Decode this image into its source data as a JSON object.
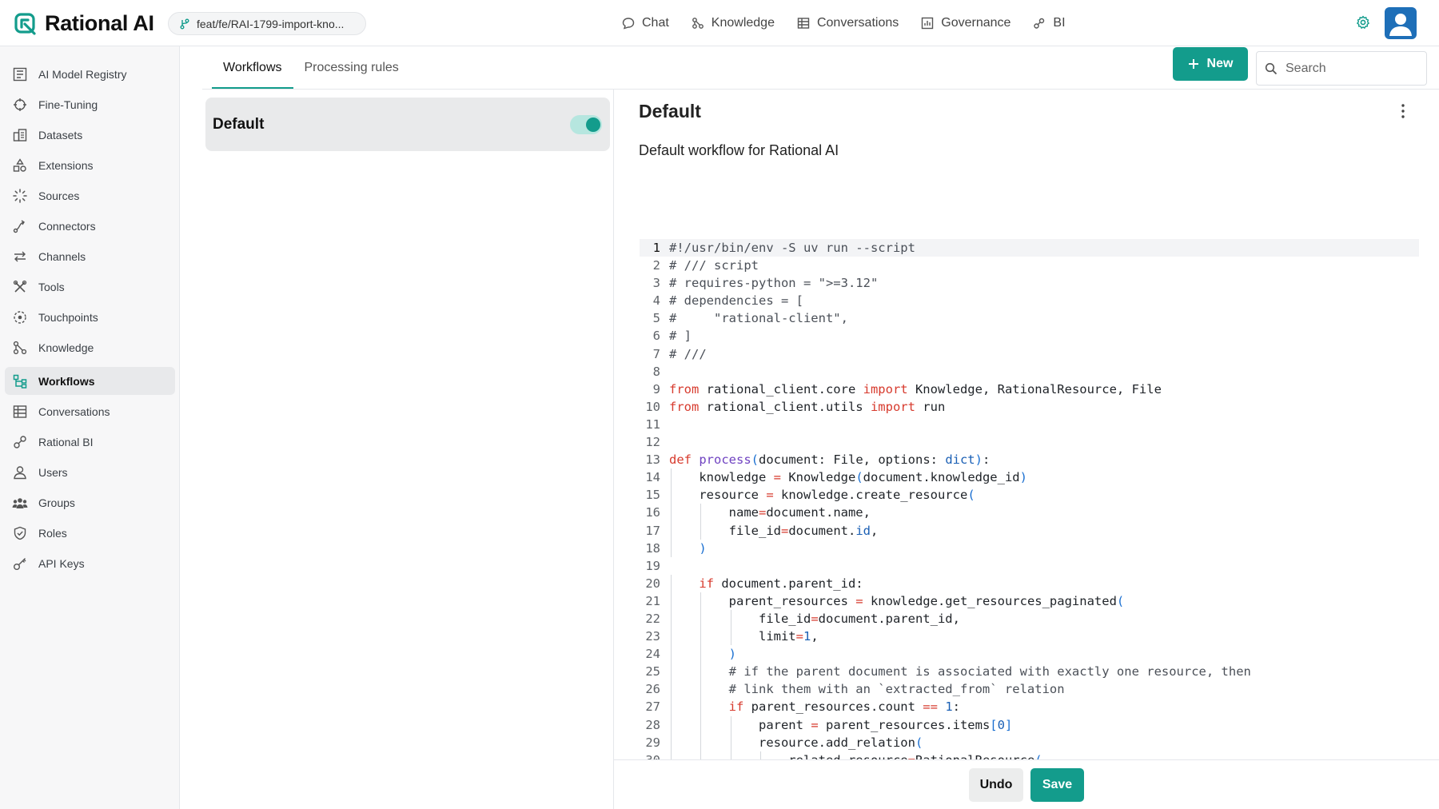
{
  "app": {
    "brand": "Rational AI",
    "branch": "feat/fe/RAI-1799-import-kno...",
    "accent_color": "#139c8c"
  },
  "topnav": [
    {
      "label": "Chat",
      "icon": "chat-icon"
    },
    {
      "label": "Knowledge",
      "icon": "knowledge-icon"
    },
    {
      "label": "Conversations",
      "icon": "table-icon"
    },
    {
      "label": "Governance",
      "icon": "governance-icon"
    },
    {
      "label": "BI",
      "icon": "bi-icon"
    }
  ],
  "sidebar": {
    "items": [
      {
        "label": "AI Model Registry",
        "icon": "registry-icon"
      },
      {
        "label": "Fine-Tuning",
        "icon": "fine-tuning-icon"
      },
      {
        "label": "Datasets",
        "icon": "datasets-icon"
      },
      {
        "label": "Extensions",
        "icon": "extensions-icon"
      },
      {
        "label": "Sources",
        "icon": "sources-icon"
      },
      {
        "label": "Connectors",
        "icon": "connectors-icon"
      },
      {
        "label": "Channels",
        "icon": "channels-icon"
      },
      {
        "label": "Tools",
        "icon": "tools-icon"
      },
      {
        "label": "Touchpoints",
        "icon": "touchpoints-icon"
      },
      {
        "label": "Knowledge",
        "icon": "knowledge-icon"
      },
      {
        "label": "Workflows",
        "icon": "workflows-icon",
        "active": true
      },
      {
        "label": "Conversations",
        "icon": "table-icon"
      },
      {
        "label": "Rational BI",
        "icon": "bi-icon"
      },
      {
        "label": "Users",
        "icon": "user-icon"
      },
      {
        "label": "Groups",
        "icon": "groups-icon"
      },
      {
        "label": "Roles",
        "icon": "shield-icon"
      },
      {
        "label": "API Keys",
        "icon": "key-icon"
      }
    ]
  },
  "tabs": [
    {
      "label": "Workflows",
      "active": true
    },
    {
      "label": "Processing rules",
      "active": false
    }
  ],
  "toolbar": {
    "new_label": "New",
    "search_placeholder": "Search"
  },
  "workflow_list": [
    {
      "name": "Default",
      "enabled": true
    }
  ],
  "detail": {
    "title": "Default",
    "description": "Default workflow for Rational AI"
  },
  "editor": {
    "current_line": 1,
    "lines": [
      "#!/usr/bin/env -S uv run --script",
      "# /// script",
      "# requires-python = \">=3.12\"",
      "# dependencies = [",
      "#     \"rational-client\",",
      "# ]",
      "# ///",
      "",
      "from rational_client.core import Knowledge, RationalResource, File",
      "from rational_client.utils import run",
      "",
      "",
      "def process(document: File, options: dict):",
      "    knowledge = Knowledge(document.knowledge_id)",
      "    resource = knowledge.create_resource(",
      "        name=document.name,",
      "        file_id=document.id,",
      "    )",
      "",
      "    if document.parent_id:",
      "        parent_resources = knowledge.get_resources_paginated(",
      "            file_id=document.parent_id,",
      "            limit=1,",
      "        )",
      "        # if the parent document is associated with exactly one resource, then",
      "        # link them with an `extracted_from` relation",
      "        if parent_resources.count == 1:",
      "            parent = parent_resources.items[0]",
      "            resource.add_relation(",
      "                related_resource=RationalResource("
    ]
  },
  "actions": {
    "undo_label": "Undo",
    "save_label": "Save"
  }
}
